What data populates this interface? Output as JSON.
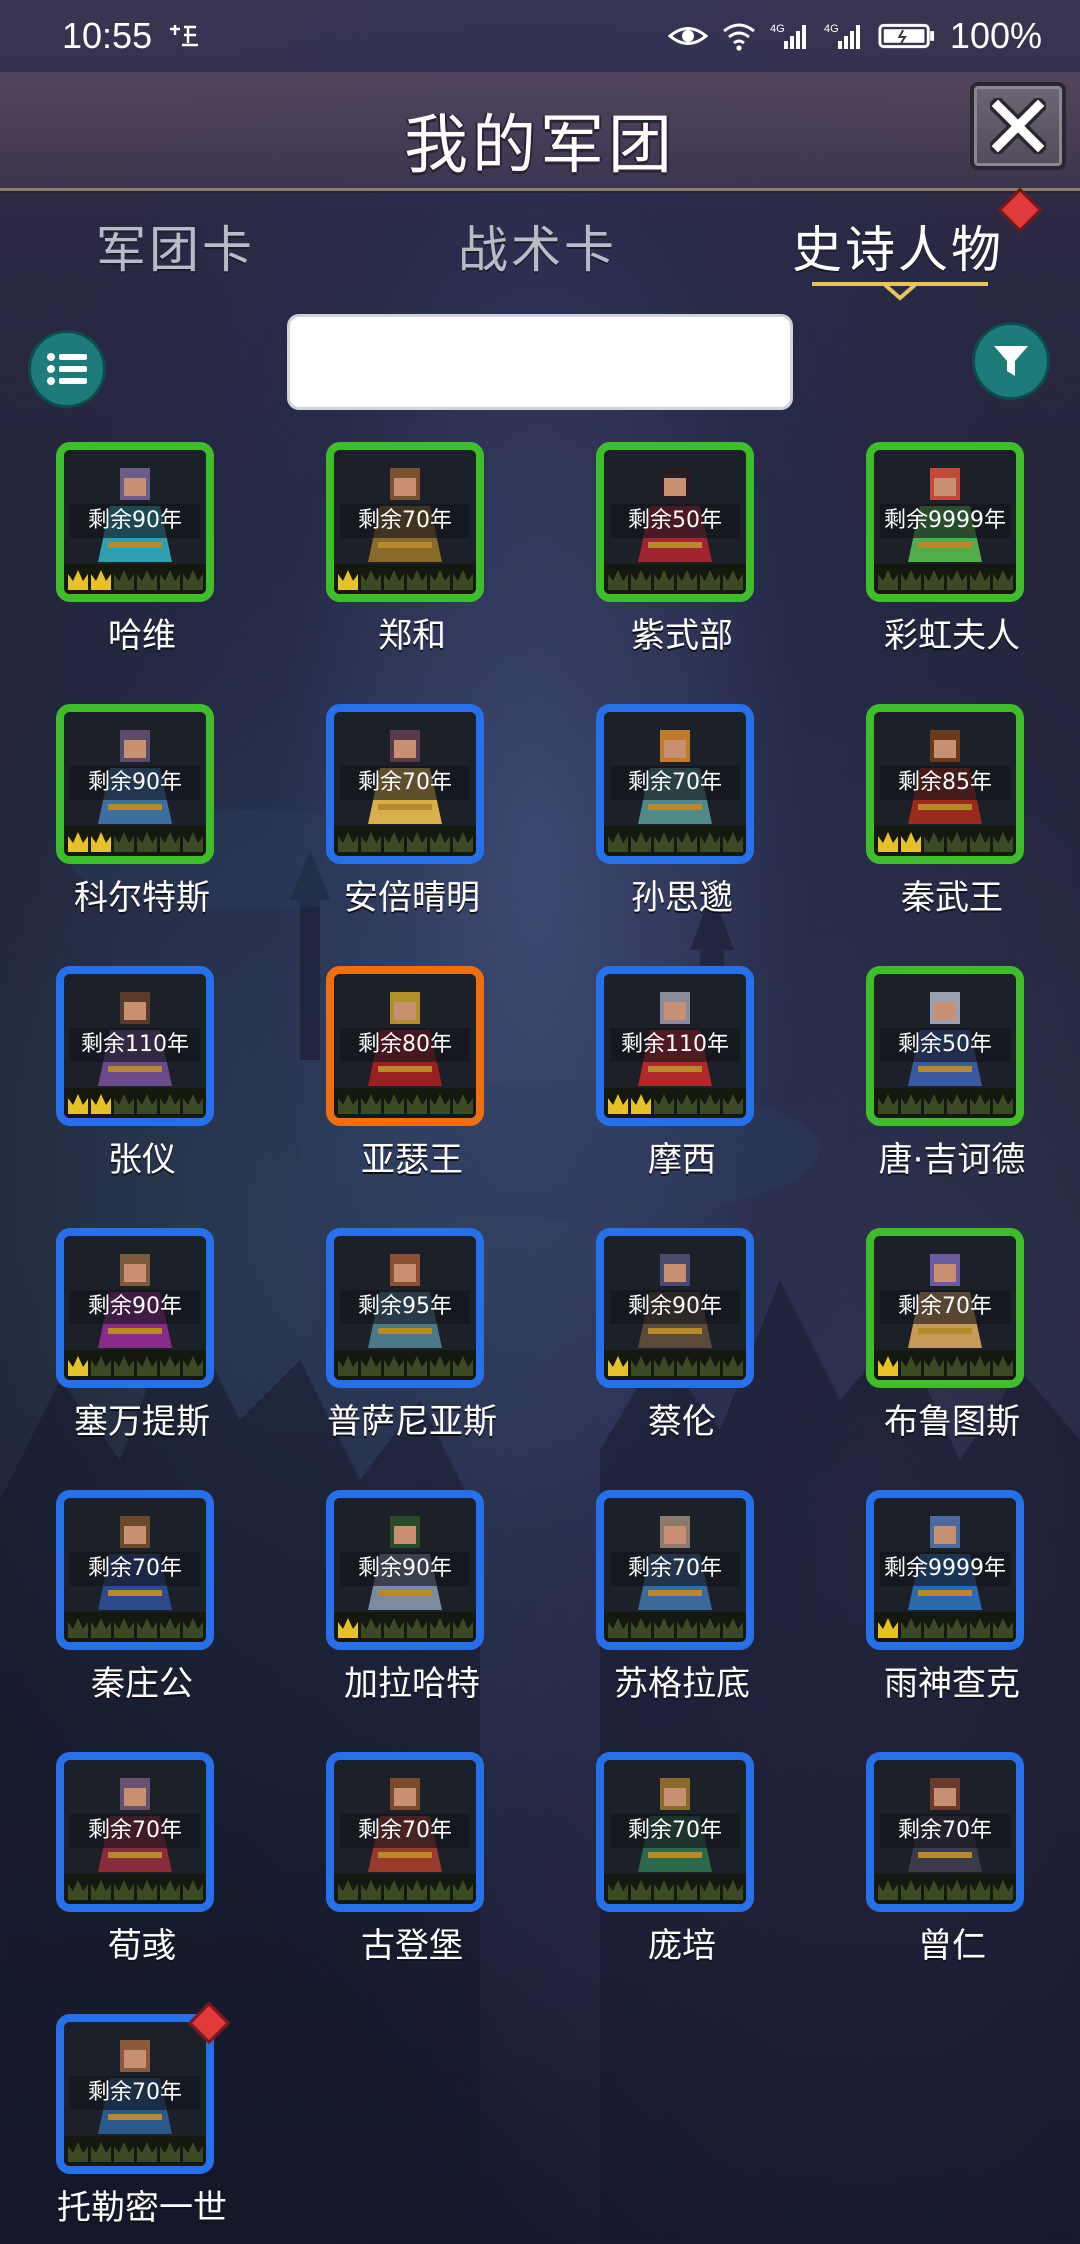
{
  "status_bar": {
    "time": "10:55",
    "battery": "100%"
  },
  "header": {
    "title": "我的军团"
  },
  "tabs": [
    {
      "label": "军团卡",
      "active": false
    },
    {
      "label": "战术卡",
      "active": false
    },
    {
      "label": "史诗人物",
      "active": true
    }
  ],
  "search": {
    "value": "",
    "placeholder": ""
  },
  "colors": {
    "frame_green": "#3fbe2c",
    "frame_blue": "#2670ea",
    "frame_orange": "#ee6e12",
    "accent_teal": "#1d7b7a",
    "crown_gold": "#e6c12a"
  },
  "heroes": [
    {
      "name": "哈维",
      "remaining": "剩余90年",
      "frame": "green",
      "gold_crowns": 2,
      "skin": "#6d5c8a",
      "cloth": "#2f9fb0"
    },
    {
      "name": "郑和",
      "remaining": "剩余70年",
      "frame": "green",
      "gold_crowns": 1,
      "skin": "#7a5230",
      "cloth": "#8a6a2a"
    },
    {
      "name": "紫式部",
      "remaining": "剩余50年",
      "frame": "green",
      "gold_crowns": 0,
      "skin": "#2a1a22",
      "cloth": "#a02530"
    },
    {
      "name": "彩虹夫人",
      "remaining": "剩余9999年",
      "frame": "green",
      "gold_crowns": 0,
      "skin": "#c24a3a",
      "cloth": "#4fae4a"
    },
    {
      "name": "科尔特斯",
      "remaining": "剩余90年",
      "frame": "green",
      "gold_crowns": 2,
      "skin": "#5b4a6a",
      "cloth": "#3a6fa0"
    },
    {
      "name": "安倍晴明",
      "remaining": "剩余70年",
      "frame": "blue",
      "gold_crowns": 0,
      "skin": "#5a3a4a",
      "cloth": "#d8b04a"
    },
    {
      "name": "孙思邈",
      "remaining": "剩余70年",
      "frame": "blue",
      "gold_crowns": 0,
      "skin": "#c07a2a",
      "cloth": "#4e8a8a"
    },
    {
      "name": "秦武王",
      "remaining": "剩余85年",
      "frame": "green",
      "gold_crowns": 2,
      "skin": "#6a3a1a",
      "cloth": "#9a2a1a"
    },
    {
      "name": "张仪",
      "remaining": "剩余110年",
      "frame": "blue",
      "gold_crowns": 2,
      "skin": "#5a3a2a",
      "cloth": "#6a4a8a"
    },
    {
      "name": "亚瑟王",
      "remaining": "剩余80年",
      "frame": "orange",
      "gold_crowns": 0,
      "skin": "#b0902a",
      "cloth": "#9a2020"
    },
    {
      "name": "摩西",
      "remaining": "剩余110年",
      "frame": "blue",
      "gold_crowns": 2,
      "skin": "#8a8a9a",
      "cloth": "#b02828"
    },
    {
      "name": "唐·吉诃德",
      "remaining": "剩余50年",
      "frame": "green",
      "gold_crowns": 0,
      "skin": "#9aa0b0",
      "cloth": "#3a5aa0"
    },
    {
      "name": "塞万提斯",
      "remaining": "剩余90年",
      "frame": "blue",
      "gold_crowns": 1,
      "skin": "#7a5a3a",
      "cloth": "#8a2a8a"
    },
    {
      "name": "普萨尼亚斯",
      "remaining": "剩余95年",
      "frame": "blue",
      "gold_crowns": 0,
      "skin": "#8a5030",
      "cloth": "#4a7a8a"
    },
    {
      "name": "蔡伦",
      "remaining": "剩余90年",
      "frame": "blue",
      "gold_crowns": 1,
      "skin": "#4a4a70",
      "cloth": "#5a4a3a"
    },
    {
      "name": "布鲁图斯",
      "remaining": "剩余70年",
      "frame": "green",
      "gold_crowns": 1,
      "skin": "#6a5aa0",
      "cloth": "#c89a5a"
    },
    {
      "name": "秦庄公",
      "remaining": "剩余70年",
      "frame": "blue",
      "gold_crowns": 0,
      "skin": "#6a4a2a",
      "cloth": "#2a4a8a"
    },
    {
      "name": "加拉哈特",
      "remaining": "剩余90年",
      "frame": "blue",
      "gold_crowns": 1,
      "skin": "#2a4a2a",
      "cloth": "#7a8aa0"
    },
    {
      "name": "苏格拉底",
      "remaining": "剩余70年",
      "frame": "blue",
      "gold_crowns": 0,
      "skin": "#8a7a6a",
      "cloth": "#3a6a9a"
    },
    {
      "name": "雨神查克",
      "remaining": "剩余9999年",
      "frame": "blue",
      "gold_crowns": 1,
      "skin": "#4a6aa0",
      "cloth": "#2a6ab0"
    },
    {
      "name": "荀彧",
      "remaining": "剩余70年",
      "frame": "blue",
      "gold_crowns": 0,
      "skin": "#6a5070",
      "cloth": "#8a2a3a"
    },
    {
      "name": "古登堡",
      "remaining": "剩余70年",
      "frame": "blue",
      "gold_crowns": 0,
      "skin": "#7a4a2a",
      "cloth": "#9a3a2a"
    },
    {
      "name": "庞培",
      "remaining": "剩余70年",
      "frame": "blue",
      "gold_crowns": 0,
      "skin": "#8a6a2a",
      "cloth": "#2a6a4a"
    },
    {
      "name": "曾仁",
      "remaining": "剩余70年",
      "frame": "blue",
      "gold_crowns": 0,
      "skin": "#6a3a2a",
      "cloth": "#3a3a4a"
    },
    {
      "name": "托勒密一世",
      "remaining": "剩余70年",
      "frame": "blue",
      "gold_crowns": 0,
      "skin": "#8a5a3a",
      "cloth": "#2a5a8a",
      "badge": true
    }
  ]
}
